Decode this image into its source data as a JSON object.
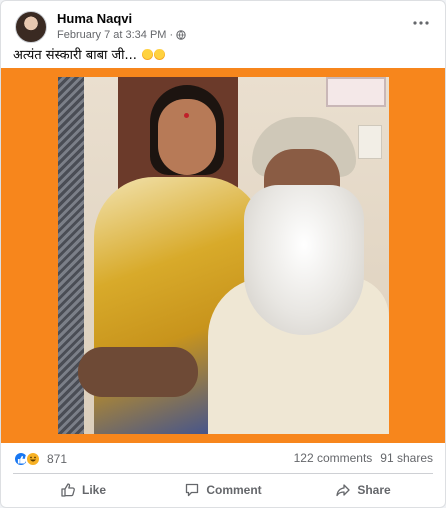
{
  "post": {
    "author": "Huma Naqvi",
    "timestamp": "February 7 at 3:34 PM",
    "separator": "·",
    "caption": "अत्यंत संस्कारी बाबा जी...",
    "caption_emoji": "thinking-face-icon"
  },
  "media": {
    "background_color": "#f7861c"
  },
  "stats": {
    "reaction_count": "871",
    "comments": "122 comments",
    "shares": "91 shares"
  },
  "actions": {
    "like": "Like",
    "comment": "Comment",
    "share": "Share"
  },
  "colors": {
    "like_blue": "#1877f2",
    "haha_yellow": "#f7b125",
    "secondary_text": "#65676b"
  }
}
